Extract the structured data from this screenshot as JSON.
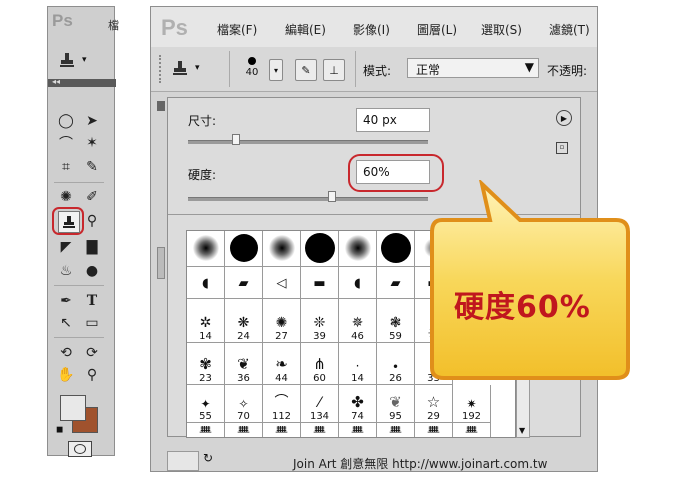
{
  "toolbox": {
    "logo": "Ps",
    "title_fragment": "檔"
  },
  "app": {
    "logo": "Ps"
  },
  "menu": {
    "items": [
      "檔案(F)",
      "編輯(E)",
      "影像(I)",
      "圖層(L)",
      "選取(S)",
      "濾鏡(T)"
    ]
  },
  "options_bar": {
    "brush_size": "40",
    "mode_label": "模式:",
    "mode_value": "正常",
    "opacity_label": "不透明:"
  },
  "brush_panel": {
    "size_label": "尺寸:",
    "size_value": "40 px",
    "size_slider_fraction": 0.2,
    "hardness_label": "硬度:",
    "hardness_value": "60%",
    "hardness_slider_fraction": 0.6
  },
  "brush_presets": {
    "row_numbers_3": [
      "14",
      "24",
      "27",
      "39",
      "46",
      "59"
    ],
    "row_numbers_4": [
      "23",
      "36",
      "44",
      "60",
      "14",
      "26",
      "33"
    ],
    "row_numbers_5": [
      "55",
      "70",
      "112",
      "134",
      "74",
      "95",
      "29",
      "192"
    ]
  },
  "callout": {
    "text": "硬度60%"
  },
  "footer": {
    "credit": "Join Art 創意無限 http://www.joinart.com.tw"
  },
  "colors": {
    "foreground": "#e8e8e8",
    "background": "#a0522d",
    "highlight": "#c8282d",
    "callout_fill": "#f6c93b",
    "callout_text": "#c0171e"
  }
}
